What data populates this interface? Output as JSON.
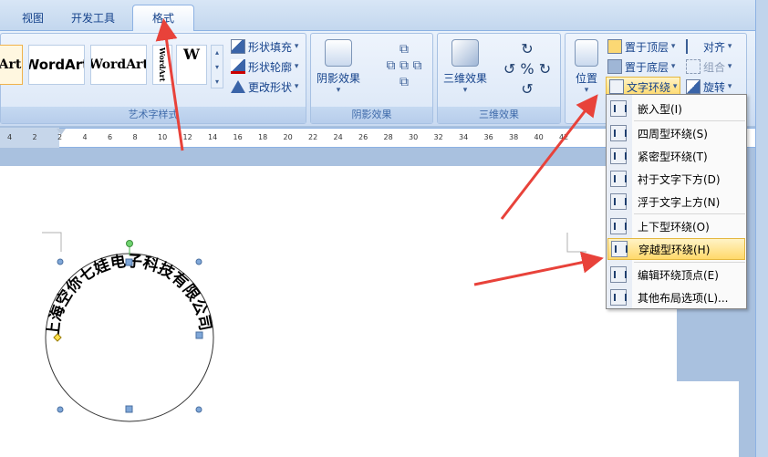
{
  "tabs": {
    "view": "视图",
    "dev": "开发工具",
    "format": "格式"
  },
  "wordart_styles": {
    "items": [
      "Art",
      "WordArt",
      "WordArt",
      "",
      "W"
    ],
    "group_label": "艺术字样式",
    "fill": "形状填充",
    "outline": "形状轮廓",
    "change_shape": "更改形状"
  },
  "shadow": {
    "button": "阴影效果",
    "group_label": "阴影效果"
  },
  "three_d": {
    "button": "三维效果",
    "group_label": "三维效果"
  },
  "arrange": {
    "position": "位置",
    "bring_front": "置于顶层",
    "send_back": "置于底层",
    "text_wrap": "文字环绕",
    "align": "对齐",
    "group": "组合",
    "rotate": "旋转"
  },
  "ruler": {
    "ticks": [
      "4",
      "2",
      "2",
      "4",
      "6",
      "8",
      "10",
      "12",
      "14",
      "16",
      "18",
      "20",
      "22",
      "24",
      "26",
      "28",
      "30",
      "32",
      "34",
      "36",
      "38",
      "40",
      "42"
    ]
  },
  "wordart_text": "上海空你七娃电子科技有限公司",
  "wrap_menu": {
    "items": [
      "嵌入型(I)",
      "四周型环绕(S)",
      "紧密型环绕(T)",
      "衬于文字下方(D)",
      "浮于文字上方(N)",
      "上下型环绕(O)",
      "穿越型环绕(H)",
      "编辑环绕顶点(E)",
      "其他布局选项(L)..."
    ],
    "highlighted_index": 6
  },
  "colors": {
    "arrow": "#e8423a",
    "highlight": "#ffd96b",
    "ribbon": "#dbe7f7"
  }
}
